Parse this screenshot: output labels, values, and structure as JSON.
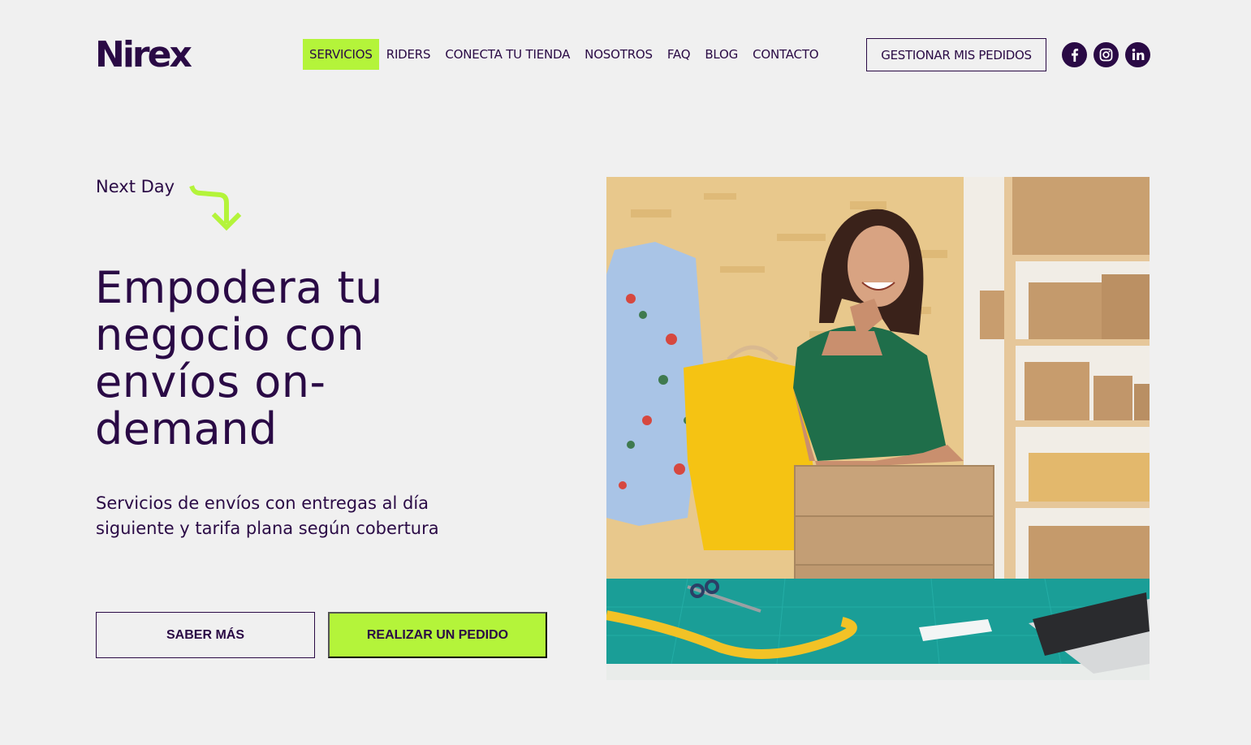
{
  "brand": {
    "logo": "Nirex"
  },
  "nav": {
    "items": [
      {
        "label": "SERVICIOS",
        "active": true
      },
      {
        "label": "RIDERS",
        "active": false
      },
      {
        "label": "CONECTA TU TIENDA",
        "active": false
      },
      {
        "label": "NOSOTROS",
        "active": false
      },
      {
        "label": "FAQ",
        "active": false
      },
      {
        "label": "BLOG",
        "active": false
      },
      {
        "label": "CONTACTO",
        "active": false
      }
    ],
    "manage_label": "GESTIONAR MIS PEDIDOS",
    "socials": [
      "facebook-icon",
      "instagram-icon",
      "linkedin-icon"
    ]
  },
  "hero": {
    "eyebrow": "Next Day",
    "headline": "Empodera tu negocio con envíos on-demand",
    "subtitle": "Servicios de envíos con entregas al día siguiente y tarifa plana según cobertura",
    "cta_secondary": "SABER MÁS",
    "cta_primary": "REALIZAR UN PEDIDO"
  },
  "colors": {
    "accent": "#b4f43a",
    "brand": "#2a0a45",
    "background": "#f0f0f0"
  }
}
